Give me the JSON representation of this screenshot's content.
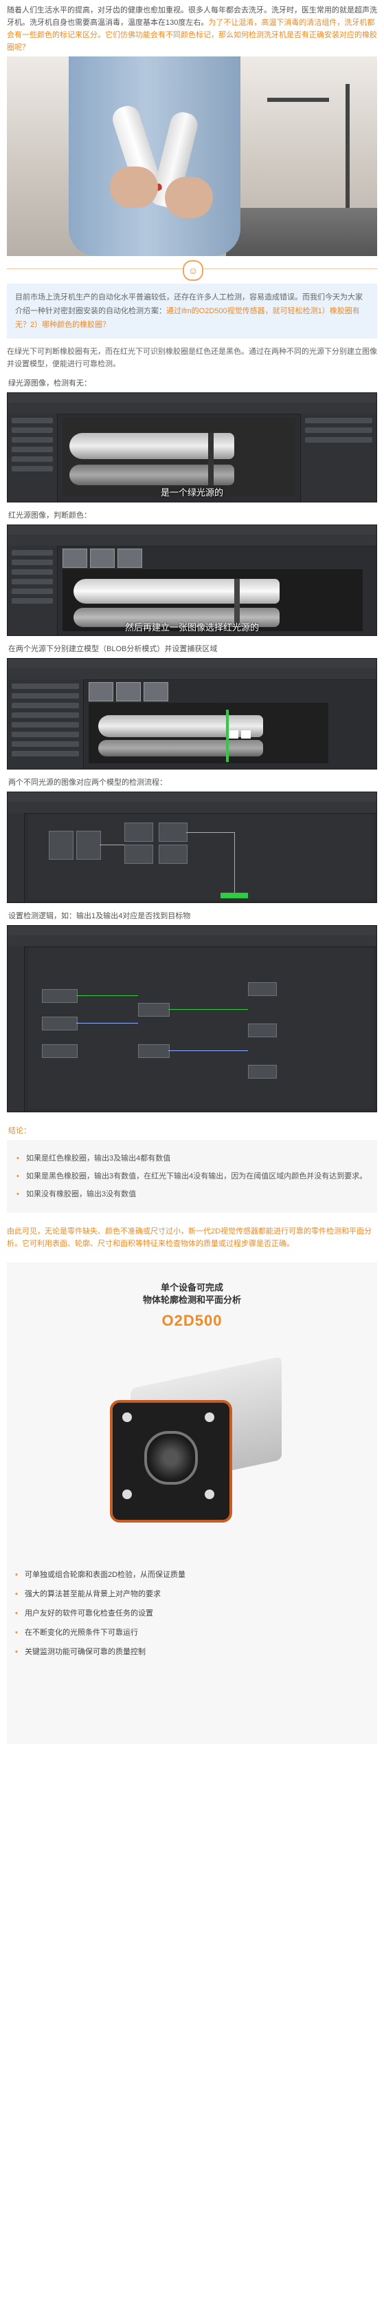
{
  "intro_paragraph": "随着人们生活水平的提高，对牙齿的健康也愈加重视。很多人每年都会去洗牙。洗牙时，医生常用的就是超声洗牙机。洗牙机自身也需要高温消毒，温度基本在130度左右。",
  "intro_highlight": "为了不让混淆，高温下消毒的清洁组件，洗牙机都会有一些颜色的标记来区分。它们仿佛功能会有不同颜色标记，那么如何检测洗牙机是否有正确安装对应的橡胶圈呢？",
  "blue_box": {
    "text": "目前市场上洗牙机生产的自动化水平普遍较低，还存在许多人工检测，容易造成错误。而我们今天为大家介绍一种针对密封圈安装的自动化检测方案：",
    "highlight": "通过ifm的O2D500视觉传感器，就可轻松检测1）橡胶圈有无？2）哪种颜色的橡胶圈？"
  },
  "method_paragraph": "在绿光下可判断橡胶圈有无，而在红光下可识别橡胶圈是红色还是黑色。通过在两种不同的光源下分别建立图像并设置模型，便能进行可靠检测。",
  "step1": {
    "caption": "绿光源图像，检测有无：",
    "subtitle": "是一个绿光源的"
  },
  "step2": {
    "caption": "红光源图像，判断颜色：",
    "subtitle": "然后再建立一张图像选择红光源的"
  },
  "step3": {
    "caption": "在两个光源下分别建立模型（BLOB分析模式）并设置捕获区域"
  },
  "step4": {
    "caption": "两个不同光源的图像对应两个模型的检测流程："
  },
  "step5": {
    "caption": "设置检测逻辑，如：输出1及输出4对应是否找到目标物"
  },
  "conclusion": {
    "title": "结论：",
    "items": [
      "如果是红色橡胶圈，输出3及输出4都有数值",
      "如果是黑色橡胶圈，输出3有数值，在红光下输出4没有输出，因为在阈值区域内颜色并没有达到要求。",
      "如果没有橡胶圈，输出3没有数值"
    ]
  },
  "summary_paragraph": "由此可见，无论是零件缺失、颜色不准确或尺寸过小，新一代2D视觉传感器都能进行可靠的零件检测和平面分析。它可利用表面、轮廓、尺寸和面积等特征来检查物体的质量或过程步骤是否正确。",
  "product": {
    "line1": "单个设备可完成",
    "line2": "物体轮廓检测和平面分析",
    "model": "O2D500",
    "features": [
      "可单独或组合轮廓和表面2D检验，从而保证质量",
      "强大的算法甚至能从背景上对产物的要求",
      "用户友好的软件可靠化检查任务的设置",
      "在不断变化的光照条件下可靠运行",
      "关键监测功能可确保可靠的质量控制"
    ]
  },
  "colors": {
    "accent": "#f08a24",
    "blue_box": "#eaf3fb",
    "ui_dark": "#2b2d30"
  }
}
